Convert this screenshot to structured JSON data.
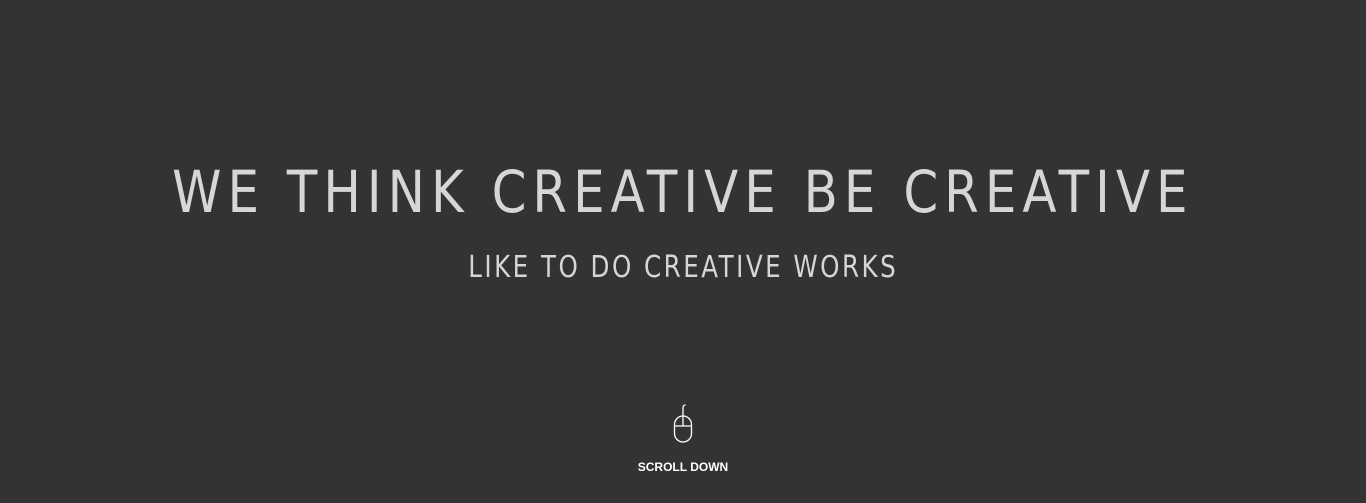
{
  "hero": {
    "headline": "WE THINK CREATIVE BE CREATIVE",
    "subheadline": "LIKE TO DO CREATIVE WORKS"
  },
  "scroll_hint": {
    "icon": "mouse-icon",
    "label": "SCROLL DOWN"
  },
  "colors": {
    "background": "#333333",
    "heading_text": "#d6d6d6",
    "label_text": "#ffffff"
  }
}
